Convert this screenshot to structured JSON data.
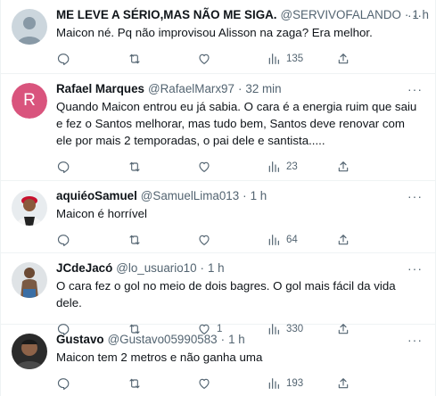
{
  "tweets": [
    {
      "name": "ME LEVE A SÉRIO,MAS NÃO ME SIGA.",
      "handle": "@SERVIVOFALANDO",
      "dot": "·",
      "time": "1 h",
      "text": "Maicon né. Pq não improvisou Alisson na zaga? Era melhor.",
      "replies": "",
      "retweets": "",
      "likes": "",
      "views": "135",
      "avatar": "default-avatar"
    },
    {
      "name": "Rafael Marques",
      "handle": "@RafaelMarx97",
      "dot": "·",
      "time": "32 min",
      "text": "Quando Maicon entrou eu já sabia. O cara é a energia ruim que saiu e fez o Santos melhorar, mas tudo bem, Santos deve renovar com ele por mais 2 temporadas, o pai dele e santista.....",
      "replies": "",
      "retweets": "",
      "likes": "",
      "views": "23",
      "avatar": "letter-avatar",
      "avatar_letter": "R",
      "avatar_color": "#d9547d"
    },
    {
      "name": "aquiéoSamuel",
      "handle": "@SamuelLima013",
      "dot": "·",
      "time": "1 h",
      "text": "Maicon é horrível",
      "replies": "",
      "retweets": "",
      "likes": "",
      "views": "64",
      "avatar": "photo-avatar"
    },
    {
      "name": "JCdeJacó",
      "handle": "@lo_usuario10",
      "dot": "·",
      "time": "1 h",
      "text": "O cara fez o gol no meio de dois bagres. O gol mais fácil da vida dele.",
      "replies": "",
      "retweets": "",
      "likes": "1",
      "views": "330",
      "avatar": "photo-avatar"
    },
    {
      "name": "Gustavo",
      "handle": "@Gustavo05990583",
      "dot": "·",
      "time": "1 h",
      "text": "Maicon tem 2 metros e não ganha uma",
      "replies": "",
      "retweets": "",
      "likes": "",
      "views": "193",
      "avatar": "photo-avatar"
    }
  ],
  "more_label": "···",
  "colors": {
    "text": "#0f1419",
    "secondary": "#536471",
    "divider": "#eff3f4"
  },
  "icons": [
    "reply-icon",
    "retweet-icon",
    "like-icon",
    "views-icon",
    "share-icon",
    "more-icon"
  ]
}
